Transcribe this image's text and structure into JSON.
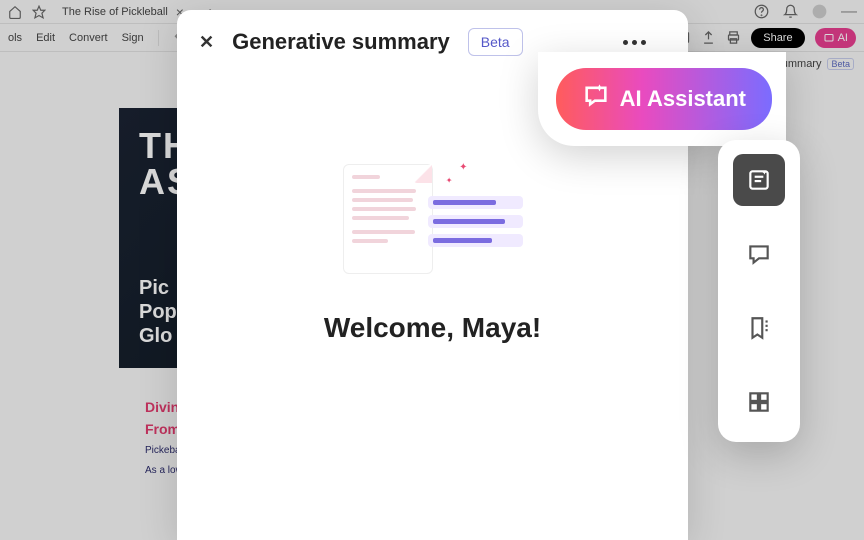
{
  "tab": {
    "title": "The Rise of Pickleball"
  },
  "toolbar": {
    "tools": "ols",
    "edit": "Edit",
    "convert": "Convert",
    "sign": "Sign",
    "share": "Share",
    "ai": "AI"
  },
  "summaryRow": {
    "label": "ummary",
    "beta": "Beta"
  },
  "panel": {
    "title": "Generative summary",
    "beta": "Beta",
    "welcome": "Welcome, Maya!"
  },
  "aiAssistant": {
    "label": "AI Assistant"
  },
  "document": {
    "titleLine1": "TH",
    "titleLine2": "AS",
    "subtitle1": "Pic",
    "subtitle2": "Pop",
    "subtitle3": "Glo",
    "heading1": "Divin",
    "heading2": "From",
    "para1": "Pickeba experie in the r and acc compet",
    "para2": "As a low ages an and out"
  }
}
